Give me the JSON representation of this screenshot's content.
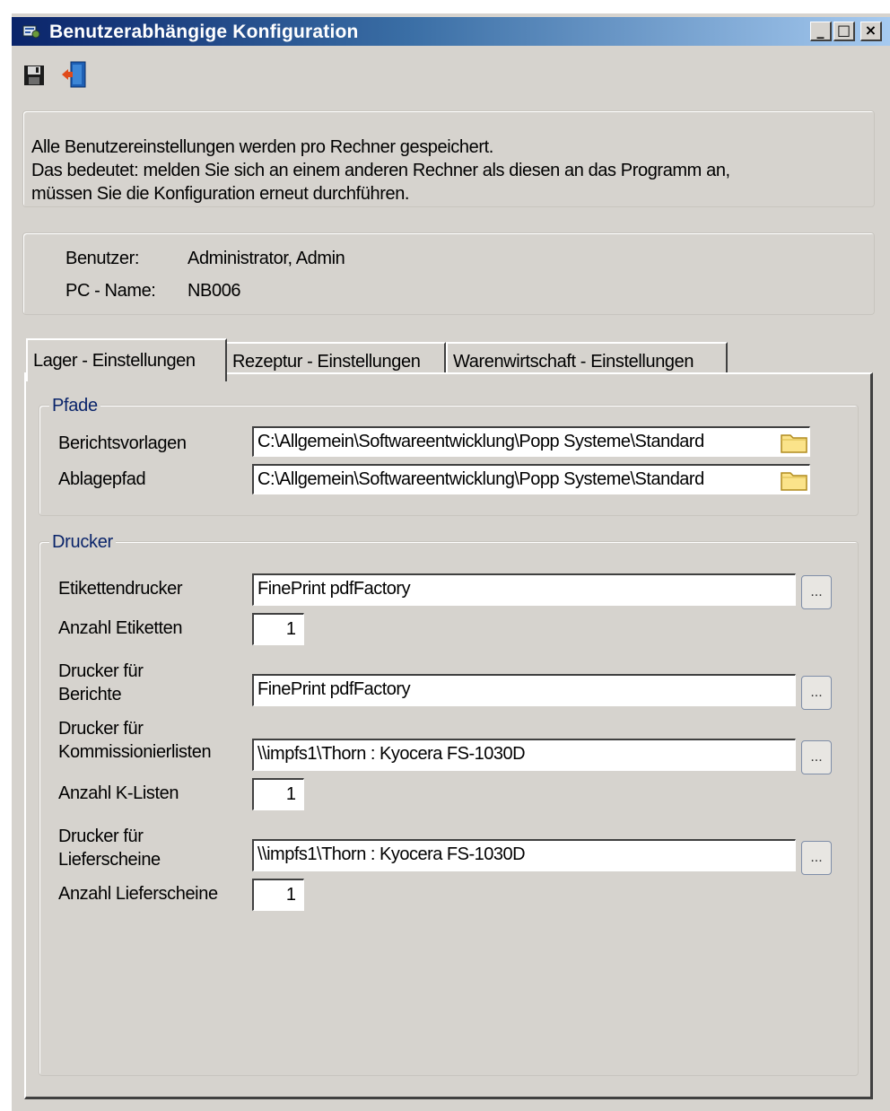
{
  "window": {
    "title": "Benutzerabhängige Konfiguration",
    "controls": {
      "minimize": "_",
      "maximize": "□",
      "close": "×"
    }
  },
  "toolbar": {
    "save_icon": "save-disk-icon",
    "exit_icon": "exit-door-icon"
  },
  "info": {
    "lines": [
      "Alle Benutzereinstellungen werden pro Rechner gespeichert.",
      "Das bedeutet: melden Sie sich an einem anderen Rechner als diesen an das Programm an,",
      "müssen Sie die Konfiguration erneut durchführen."
    ]
  },
  "user": {
    "user_label": "Benutzer:",
    "user_value": "Administrator, Admin",
    "pc_label": "PC - Name:",
    "pc_value": "NB006"
  },
  "tabs": [
    {
      "label": "Lager - Einstellungen",
      "active": true
    },
    {
      "label": "Rezeptur - Einstellungen",
      "active": false
    },
    {
      "label": "Warenwirtschaft - Einstellungen",
      "active": false
    }
  ],
  "paths": {
    "legend": "Pfade",
    "berichtsvorlagen_label": "Berichtsvorlagen",
    "berichtsvorlagen_value": "C:\\Allgemein\\Softwareentwicklung\\Popp Systeme\\Standard",
    "ablagepfad_label": "Ablagepfad",
    "ablagepfad_value": "C:\\Allgemein\\Softwareentwicklung\\Popp Systeme\\Standard",
    "folder_icon": "folder-icon"
  },
  "printers": {
    "legend": "Drucker",
    "browse_label": "...",
    "etikettendrucker_label": "Etikettendrucker",
    "etikettendrucker_value": "FinePrint pdfFactory",
    "anzahl_etiketten_label": "Anzahl Etiketten",
    "anzahl_etiketten_value": "1",
    "berichte_label_1": "Drucker für",
    "berichte_label_2": "Berichte",
    "berichte_value": "FinePrint pdfFactory",
    "kommission_label_1": "Drucker für",
    "kommission_label_2": "Kommissionierlisten",
    "kommission_value": "\\\\impfs1\\Thorn : Kyocera FS-1030D",
    "anzahl_klisten_label": "Anzahl K-Listen",
    "anzahl_klisten_value": "1",
    "lieferscheine_label_1": "Drucker für",
    "lieferscheine_label_2": "Lieferscheine",
    "lieferscheine_value": "\\\\impfs1\\Thorn : Kyocera FS-1030D",
    "anzahl_lieferscheine_label": "Anzahl Lieferscheine",
    "anzahl_lieferscheine_value": "1"
  },
  "colors": {
    "title_gradient_start": "#0a246a",
    "title_gradient_end": "#a6caf0",
    "window_face": "#d6d3ce",
    "legend_text": "#0a246a"
  }
}
